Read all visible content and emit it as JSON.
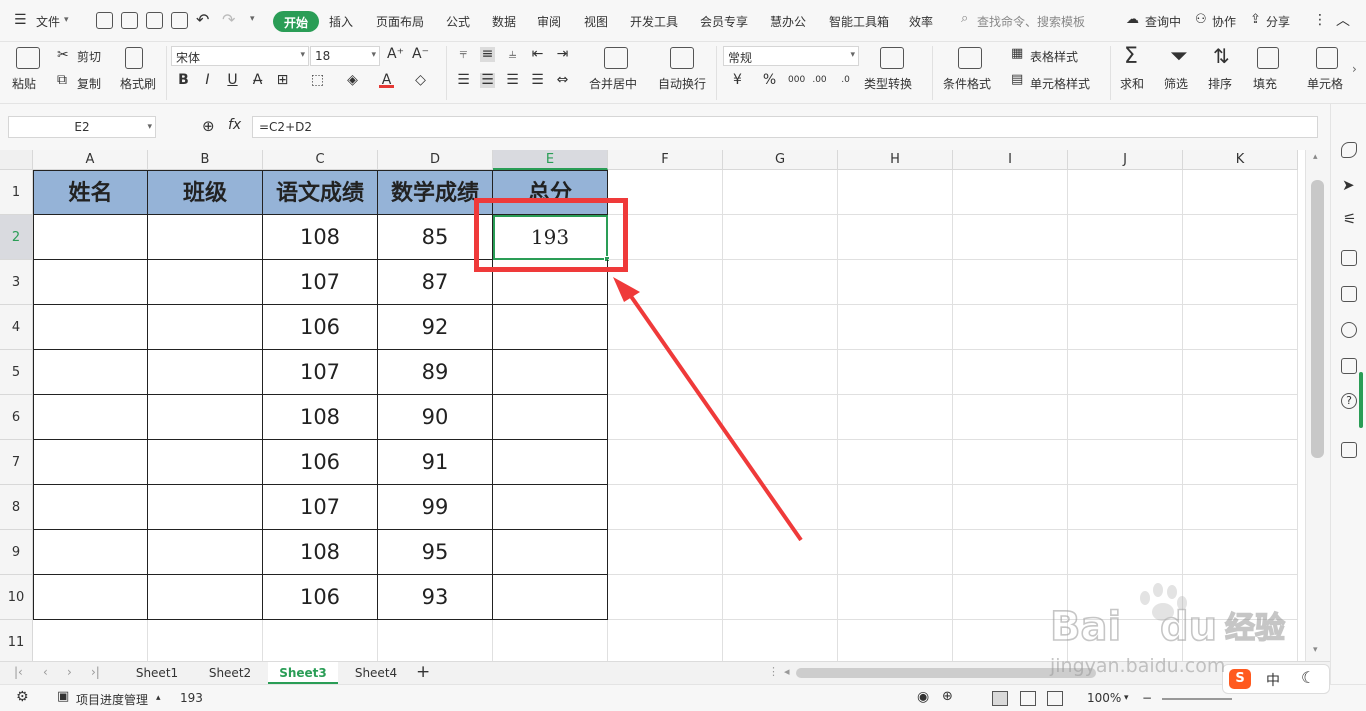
{
  "menubar": {
    "file": "文件",
    "tabs": [
      "开始",
      "插入",
      "页面布局",
      "公式",
      "数据",
      "审阅",
      "视图",
      "开发工具",
      "会员专享",
      "慧办公",
      "智能工具箱",
      "效率"
    ],
    "search": "查找命令、搜索模板",
    "right": [
      "查询中",
      "协作",
      "分享"
    ]
  },
  "ribbon": {
    "paste": "粘贴",
    "cut": "剪切",
    "copy": "复制",
    "format_painter": "格式刷",
    "font_name": "宋体",
    "font_size": "18",
    "bold": "B",
    "italic": "I",
    "underline": "U",
    "merge": "合并居中",
    "wrap": "自动换行",
    "num_format": "常规",
    "type_convert": "类型转换",
    "cond_format": "条件格式",
    "table_style": "表格样式",
    "cell_style": "单元格样式",
    "sum": "求和",
    "filter": "筛选",
    "sort": "排序",
    "fill": "填充",
    "cell": "单元格"
  },
  "formula": {
    "namebox": "E2",
    "fx": "fx",
    "content": "=C2+D2"
  },
  "columns": [
    "A",
    "B",
    "C",
    "D",
    "E",
    "F",
    "G",
    "H",
    "I",
    "J",
    "K"
  ],
  "rows": [
    "1",
    "2",
    "3",
    "4",
    "5",
    "6",
    "7",
    "8",
    "9",
    "10",
    "11"
  ],
  "table": {
    "headers": [
      "姓名",
      "班级",
      "语文成绩",
      "数学成绩",
      "总分"
    ],
    "chinese": [
      "108",
      "107",
      "106",
      "107",
      "108",
      "106",
      "107",
      "108",
      "106"
    ],
    "math": [
      "85",
      "87",
      "92",
      "89",
      "90",
      "91",
      "99",
      "95",
      "93"
    ],
    "total_e2": "193"
  },
  "sheets": [
    "Sheet1",
    "Sheet2",
    "Sheet3",
    "Sheet4"
  ],
  "status": {
    "project": "项目进度管理",
    "value": "193",
    "zoom": "100%"
  },
  "watermark": {
    "brand": "Baidu",
    "cn": "经验",
    "url": "jingyan.baidu.com"
  },
  "colors": {
    "accent": "#2a9d56",
    "header_fill": "#95b3d7",
    "highlight": "#ef3a3a"
  }
}
